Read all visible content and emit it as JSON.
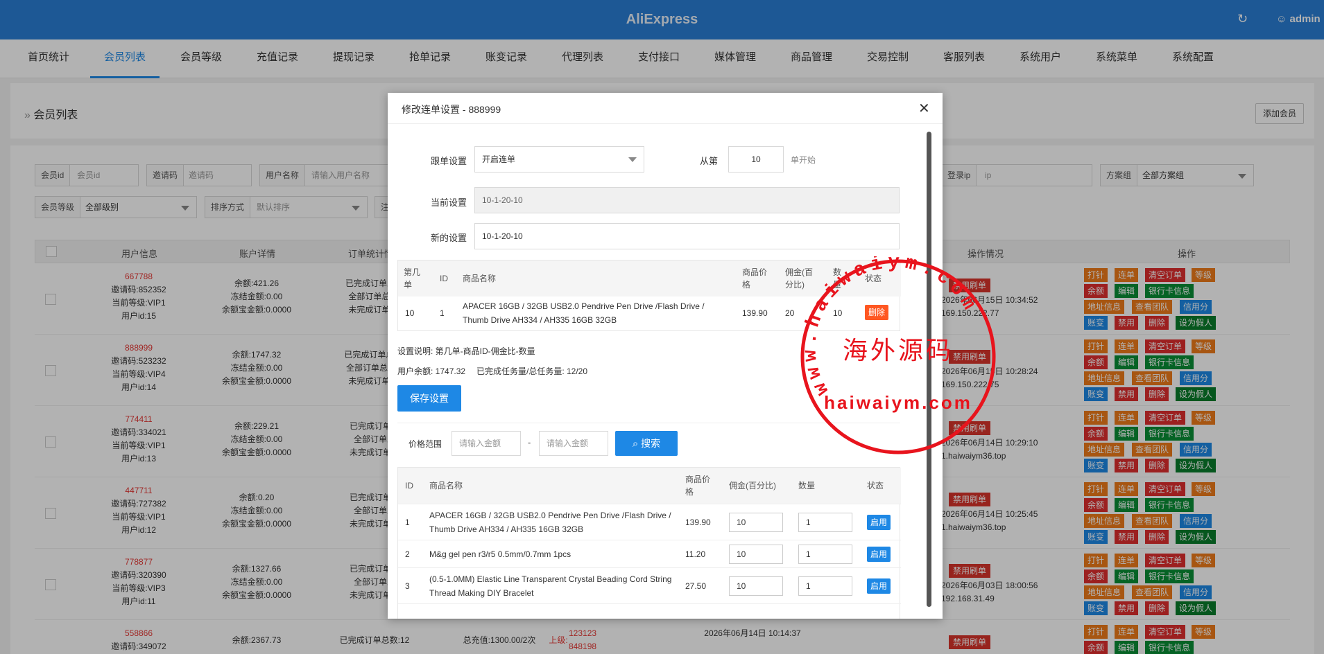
{
  "topbar": {
    "title": "AliExpress",
    "user": "admin"
  },
  "nav": [
    "首页统计",
    "会员列表",
    "会员等级",
    "充值记录",
    "提现记录",
    "抢单记录",
    "账变记录",
    "代理列表",
    "支付接口",
    "媒体管理",
    "商品管理",
    "交易控制",
    "客服列表",
    "系统用户",
    "系统菜单",
    "系统配置"
  ],
  "page": {
    "breadcrumb": "会员列表",
    "add_button": "添加会员"
  },
  "filters": {
    "member_id": {
      "label": "会员id",
      "placeholder": "会员id"
    },
    "invite": {
      "label": "邀请码",
      "placeholder": "邀请码"
    },
    "username": {
      "label": "用户名称",
      "placeholder": "请输入用户名称"
    },
    "login_ip": {
      "label": "登录ip",
      "placeholder": "ip"
    },
    "plan_group": {
      "label": "方案组",
      "value": "全部方案组"
    },
    "level": {
      "label": "会员等级",
      "value": "全部级别"
    },
    "sort": {
      "label": "排序方式",
      "value": "默认排序"
    },
    "note_label": "注"
  },
  "table": {
    "headers": [
      "用户信息",
      "账户详情",
      "订单统计情况",
      "操作情况",
      "操作"
    ]
  },
  "members": [
    {
      "id": "667788",
      "invite": "邀请码:852352",
      "level": "当前等级:VIP1",
      "uid": "用户id:15",
      "balance": "余额:421.26",
      "frozen": "冻结金额:0.00",
      "treasure": "余额宝金额:0.0000",
      "o1": "已完成订单总数",
      "o2": "全部订单总数:",
      "o3": "未完成订单数:",
      "ban": "禁用刷单",
      "time": "2026年06月15日 10:34:52",
      "ip": "169.150.222.77"
    },
    {
      "id": "888999",
      "invite": "邀请码:523232",
      "level": "当前等级:VIP4",
      "uid": "用户id:14",
      "balance": "余额:1747.32",
      "frozen": "冻结金额:0.00",
      "treasure": "余额宝金额:0.0000",
      "o1": "已完成订单总数:",
      "o2": "全部订单总数:1",
      "o3": "未完成订单数:",
      "ban": "禁用刷单",
      "time": "2026年06月15日 10:28:24",
      "ip": "169.150.222.75"
    },
    {
      "id": "774411",
      "invite": "邀请码:334021",
      "level": "当前等级:VIP1",
      "uid": "用户id:13",
      "balance": "余额:229.21",
      "frozen": "冻结金额:0.00",
      "treasure": "余额宝金额:0.0000",
      "o1": "已完成订单总",
      "o2": "全部订单总",
      "o3": "未完成订单数",
      "ban": "禁用刷单",
      "time": "2026年06月14日 10:29:10",
      "ip": "1.haiwaiym36.top"
    },
    {
      "id": "447711",
      "invite": "邀请码:727382",
      "level": "当前等级:VIP1",
      "uid": "用户id:12",
      "balance": "余额:0.20",
      "frozen": "冻结金额:0.00",
      "treasure": "余额宝金额:0.0000",
      "o1": "已完成订单总",
      "o2": "全部订单总",
      "o3": "未完成订单数",
      "ban": "禁用刷单",
      "time": "2026年06月14日 10:25:45",
      "ip": "1.haiwaiym36.top"
    },
    {
      "id": "778877",
      "invite": "邀请码:320390",
      "level": "当前等级:VIP3",
      "uid": "用户id:11",
      "balance": "余额:1327.66",
      "frozen": "冻结金额:0.00",
      "treasure": "余额宝金额:0.0000",
      "o1": "已完成订单总",
      "o2": "全部订单总",
      "o3": "未完成订单数",
      "ban": "禁用刷单",
      "time": "2026年06月03日 18:00:56",
      "ip": "192.168.31.49"
    }
  ],
  "last_row": {
    "id": "558866",
    "invite": "邀请码:349072",
    "balance": "余额:2367.73",
    "o1": "已完成订单总数:12",
    "recharge": "总充值:1300.00/2次",
    "upper_label": "上级:",
    "upper1": "123123",
    "upper2": "848198",
    "time": "2026年06月14日 10:14:37",
    "ban": "禁用刷单"
  },
  "actions": {
    "row1": [
      "打针",
      "连单",
      "清空订单",
      "等级"
    ],
    "row2": [
      "余额",
      "编辑",
      "银行卡信息"
    ],
    "row3": [
      "地址信息",
      "查看团队",
      "信用分"
    ],
    "row4": [
      "账变",
      "禁用",
      "删除",
      "设为假人"
    ]
  },
  "modal": {
    "title": "修改连单设置 - 888999",
    "follow_label": "跟单设置",
    "follow_value": "开启连单",
    "from_label": "从第",
    "from_value": "10",
    "from_suffix": "单开始",
    "current_label": "当前设置",
    "current_value": "10-1-20-10",
    "new_label": "新的设置",
    "new_value": "10-1-20-10",
    "top_table": {
      "headers": [
        "第几单",
        "ID",
        "商品名称",
        "商品价格",
        "佣金(百分比)",
        "数量",
        "状态"
      ],
      "row": {
        "n": "10",
        "id": "1",
        "name": "APACER 16GB / 32GB USB2.0 Pendrive Pen Drive /Flash Drive / Thumb Drive AH334 / AH335 16GB 32GB",
        "price": "139.90",
        "commission": "20",
        "qty": "10",
        "action": "删除"
      }
    },
    "note": "设置说明: 第几单-商品ID-佣金比-数量",
    "balance_info": "用户余额: 1747.32",
    "task_info": "已完成任务量/总任务量: 12/20",
    "save": "保存设置",
    "price_range_label": "价格范围",
    "min_placeholder": "请输入金额",
    "dash": "-",
    "max_placeholder": "请输入金额",
    "search": "搜索",
    "product_table": {
      "headers": [
        "ID",
        "商品名称",
        "商品价格",
        "佣金(百分比)",
        "数量",
        "状态"
      ],
      "rows": [
        {
          "id": "1",
          "name": "APACER 16GB / 32GB USB2.0 Pendrive Pen Drive /Flash Drive / Thumb Drive AH334 / AH335 16GB 32GB",
          "price": "139.90",
          "commission": "10",
          "qty": "1",
          "action": "启用"
        },
        {
          "id": "2",
          "name": "M&g gel pen r3/r5 0.5mm/0.7mm 1pcs",
          "price": "11.20",
          "commission": "10",
          "qty": "1",
          "action": "启用"
        },
        {
          "id": "3",
          "name": "(0.5-1.0MM) Elastic Line Transparent Crystal Beading Cord String Thread Making DIY Bracelet",
          "price": "27.50",
          "commission": "10",
          "qty": "1",
          "action": "启用"
        }
      ]
    }
  },
  "watermark": {
    "url_text": "www.haiwaiym.com",
    "brand": "海外源码",
    "domain": "haiwaiym.com"
  },
  "colors": {
    "brand_blue": "#2a7fd6",
    "primary": "#1e88e5",
    "danger": "#e02f2f",
    "warn": "#f07b1a",
    "success": "#0a8f36",
    "stamp_red": "#e8141d"
  }
}
